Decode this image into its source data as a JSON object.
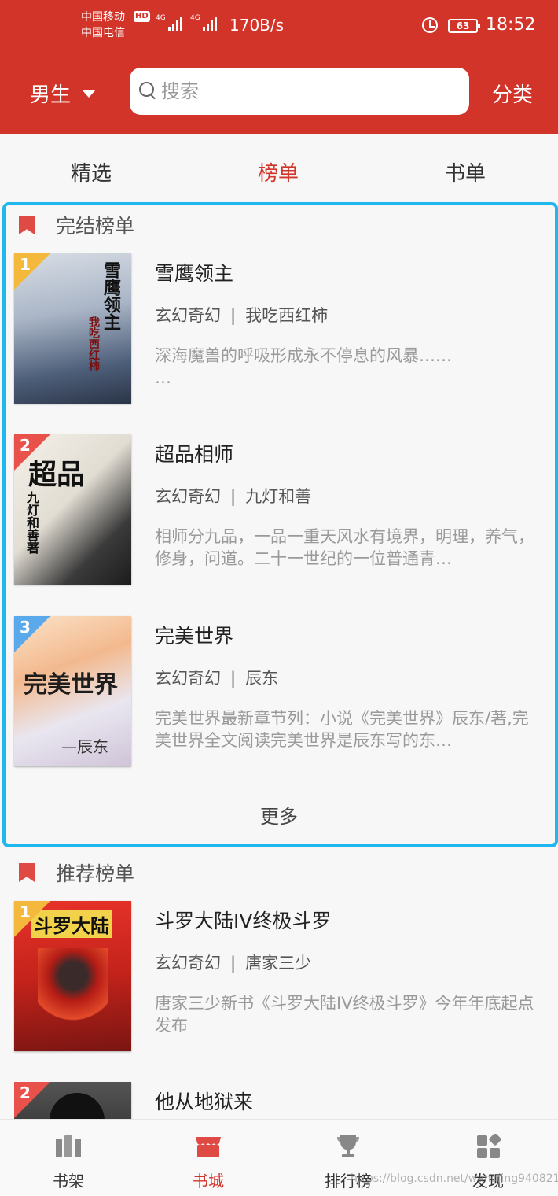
{
  "status_bar": {
    "carrier_1": "中国移动",
    "carrier_2": "中国电信",
    "hd_badge": "HD",
    "net_1": "4G",
    "net_2": "4G",
    "speed": "170B/s",
    "battery": "63",
    "time": "18:52"
  },
  "header": {
    "gender_label": "男生",
    "search_placeholder": "搜索",
    "category_label": "分类"
  },
  "tabs": [
    {
      "label": "精选",
      "active": false
    },
    {
      "label": "榜单",
      "active": true
    },
    {
      "label": "书单",
      "active": false
    }
  ],
  "sections": [
    {
      "title": "完结榜单",
      "books": [
        {
          "rank": "1",
          "title": "雪鹰领主",
          "genre": "玄幻奇幻",
          "author": "我吃西红柿",
          "desc": "深海魔兽的呼吸形成永不停息的风暴……\n…",
          "cover_text": "雪鹰领主",
          "cover_sub": "我吃西红柿"
        },
        {
          "rank": "2",
          "title": "超品相师",
          "genre": "玄幻奇幻",
          "author": "九灯和善",
          "desc": "相师分九品，一品一重天风水有境界，明理，养气，修身，问道。二十一世纪的一位普通青…",
          "cover_text": "超品",
          "cover_sub": "九灯和善著"
        },
        {
          "rank": "3",
          "title": "完美世界",
          "genre": "玄幻奇幻",
          "author": "辰东",
          "desc": "完美世界最新章节列：小说《完美世界》辰东/著,完美世界全文阅读完美世界是辰东写的东…",
          "cover_text": "完美世界",
          "cover_sub": "—辰东"
        }
      ],
      "more_label": "更多"
    },
    {
      "title": "推荐榜单",
      "books": [
        {
          "rank": "1",
          "title": "斗罗大陆IV终极斗罗",
          "genre": "玄幻奇幻",
          "author": "唐家三少",
          "desc": "唐家三少新书《斗罗大陆IV终极斗罗》今年年底起点发布",
          "cover_text": "斗罗大陆"
        },
        {
          "rank": "2",
          "title": "他从地狱来"
        }
      ]
    }
  ],
  "bottom_nav": [
    {
      "label": "书架",
      "icon": "bookshelf-icon",
      "active": false
    },
    {
      "label": "书城",
      "icon": "bookstore-icon",
      "active": true
    },
    {
      "label": "排行榜",
      "icon": "trophy-icon",
      "active": false
    },
    {
      "label": "发现",
      "icon": "discover-icon",
      "active": false
    }
  ],
  "watermark": "https://blog.csdn.net/wangjing940821",
  "colors": {
    "brand_red": "#d2342a",
    "highlight_border": "#1fb7ee",
    "rank_1": "#f4b93c",
    "rank_2": "#e9524a",
    "rank_3": "#5aa9ea"
  }
}
